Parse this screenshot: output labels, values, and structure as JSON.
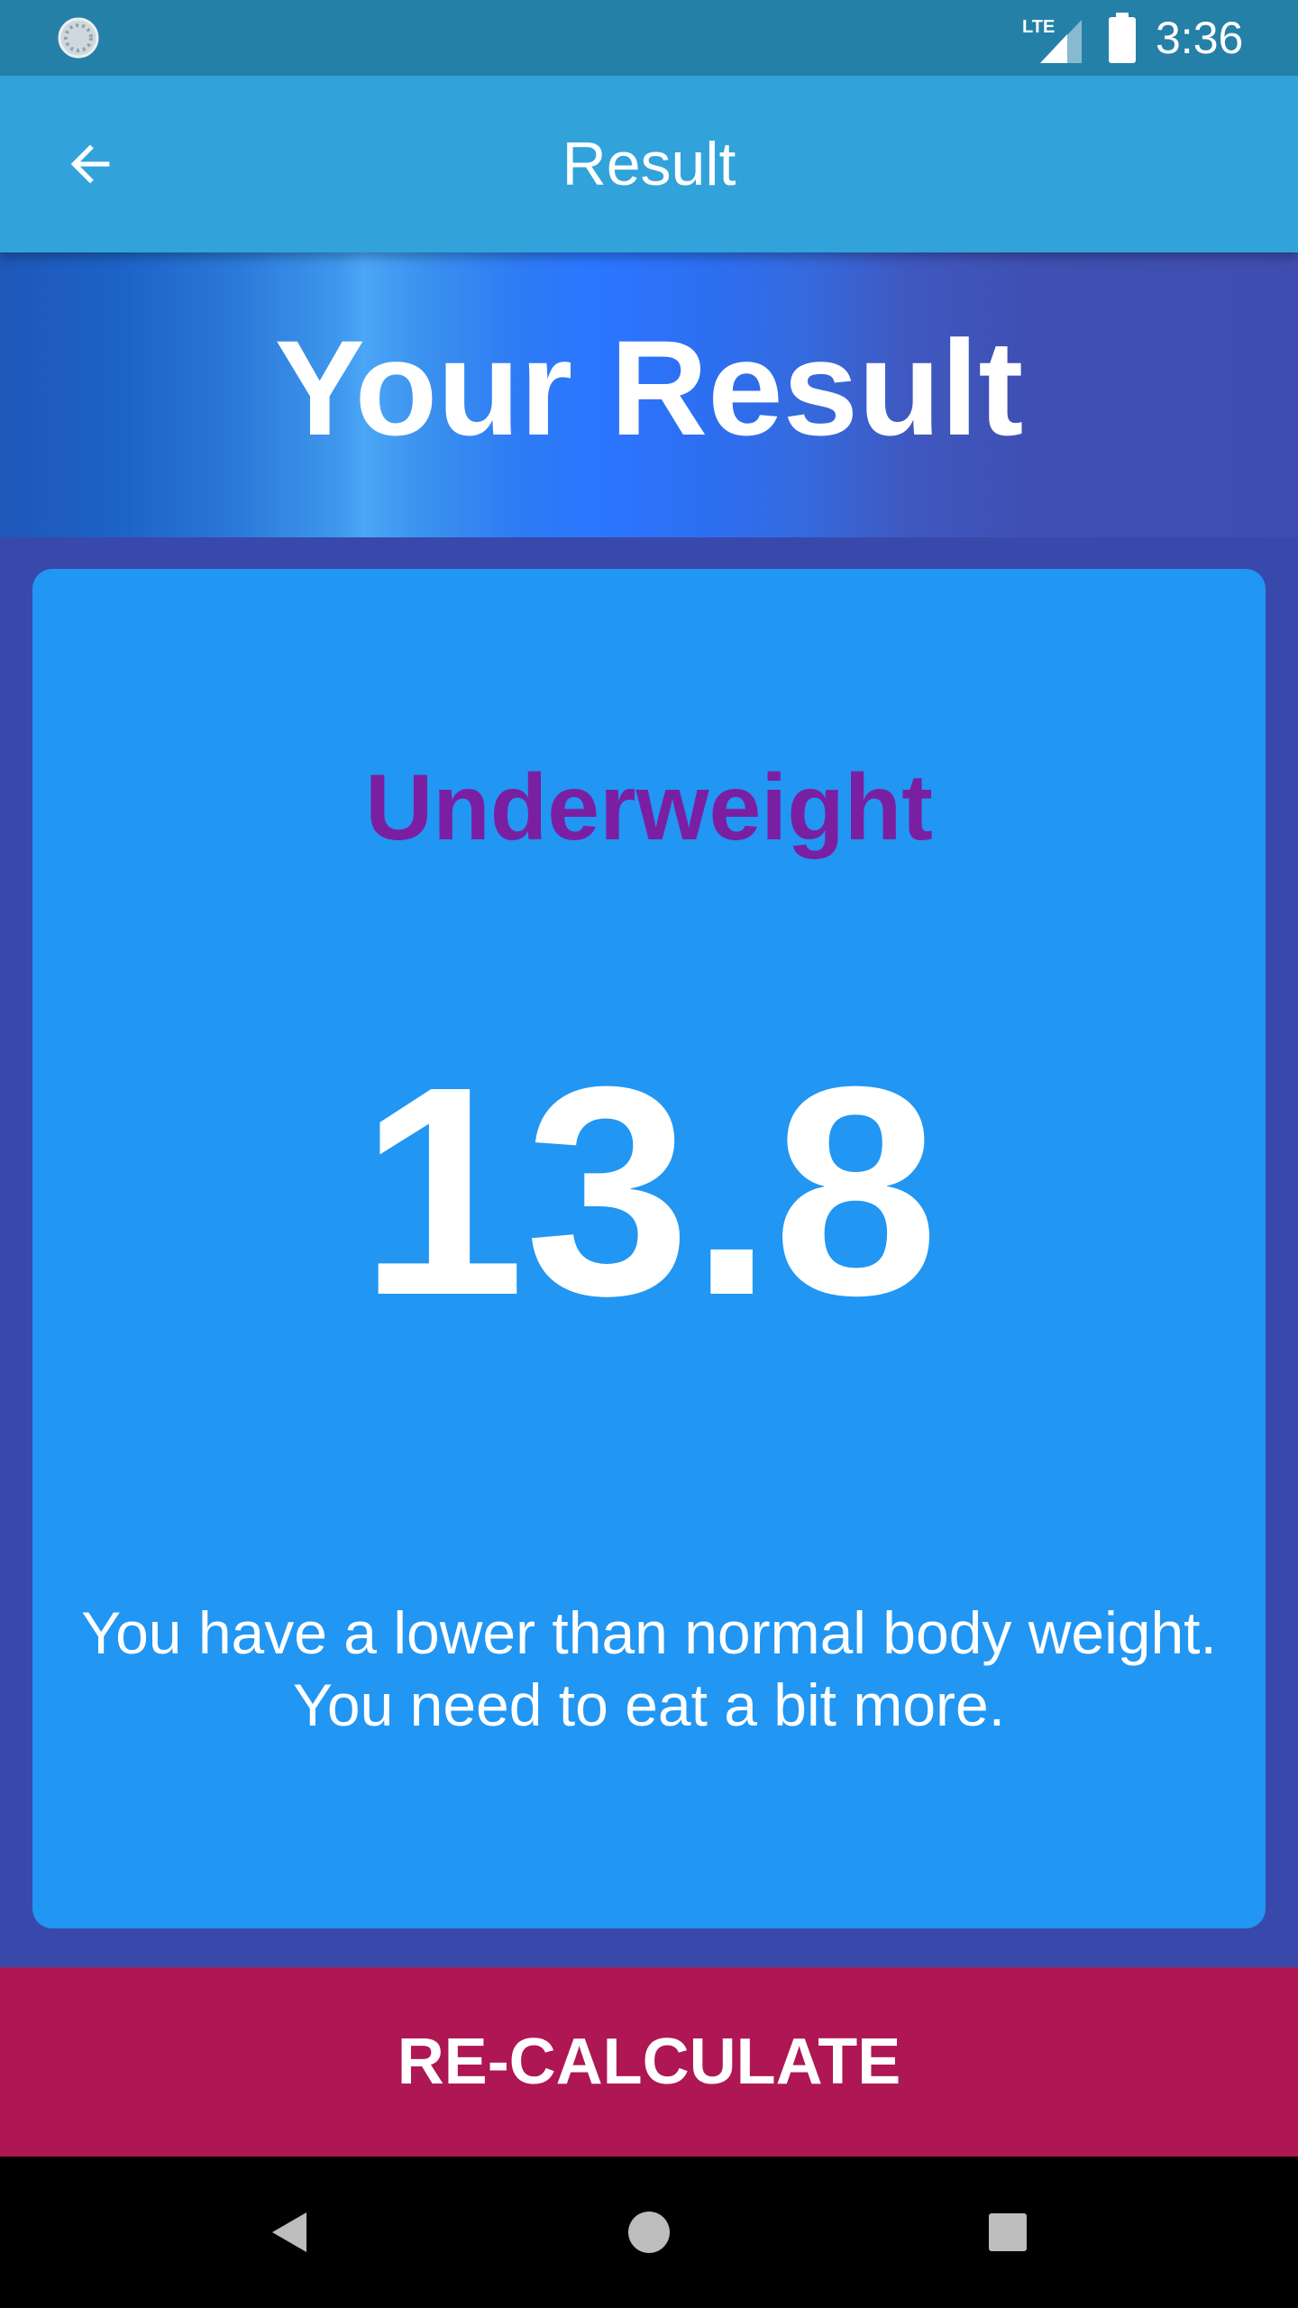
{
  "status_bar": {
    "network_label": "LTE",
    "time": "3:36",
    "icons": [
      "loading-indicator-icon",
      "lte-signal-icon",
      "battery-icon"
    ],
    "background_color": "#2580A8"
  },
  "app_bar": {
    "title": "Result",
    "back_icon": "arrow-back-icon",
    "background_color": "#31A3DA"
  },
  "hero": {
    "title": "Your Result"
  },
  "result": {
    "status": "Underweight",
    "status_color": "#7B1FA2",
    "value": "13.8",
    "message": "You have a lower than normal body weight. You need to eat a bit more.",
    "card_color": "#2196F3"
  },
  "actions": {
    "recalculate_label": "RE-CALCULATE",
    "button_color": "#AE1654"
  },
  "navigation_bar": {
    "icons": [
      "nav-back-icon",
      "nav-home-icon",
      "nav-recents-icon"
    ]
  },
  "theme": {
    "page_background": "#3949AB"
  }
}
